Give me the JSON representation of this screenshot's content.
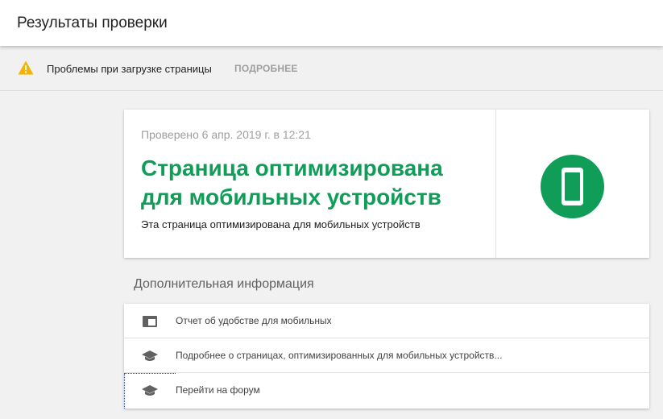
{
  "header": {
    "title": "Результаты проверки"
  },
  "warning": {
    "icon": "warning-icon",
    "text": "Проблемы при загрузке страницы",
    "link_label": "ПОДРОБНЕЕ",
    "color": "#f4b400"
  },
  "result": {
    "checked_text": "Проверено 6 апр. 2019 г. в 12:21",
    "headline": "Страница оптимизирована для мобильных устройств",
    "subtext": "Эта страница оптимизирована для мобильных устройств",
    "badge_icon": "mobile-phone-icon",
    "accent_color": "#0f9d58"
  },
  "additional": {
    "title": "Дополнительная информация",
    "items": [
      {
        "icon": "report-icon",
        "label": "Отчет об удобстве для мобильных"
      },
      {
        "icon": "graduation-cap-icon",
        "label": "Подробнее о страницах, оптимизированных для мобильных устройств..."
      },
      {
        "icon": "graduation-cap-icon",
        "label": "Перейти на форум"
      }
    ]
  }
}
